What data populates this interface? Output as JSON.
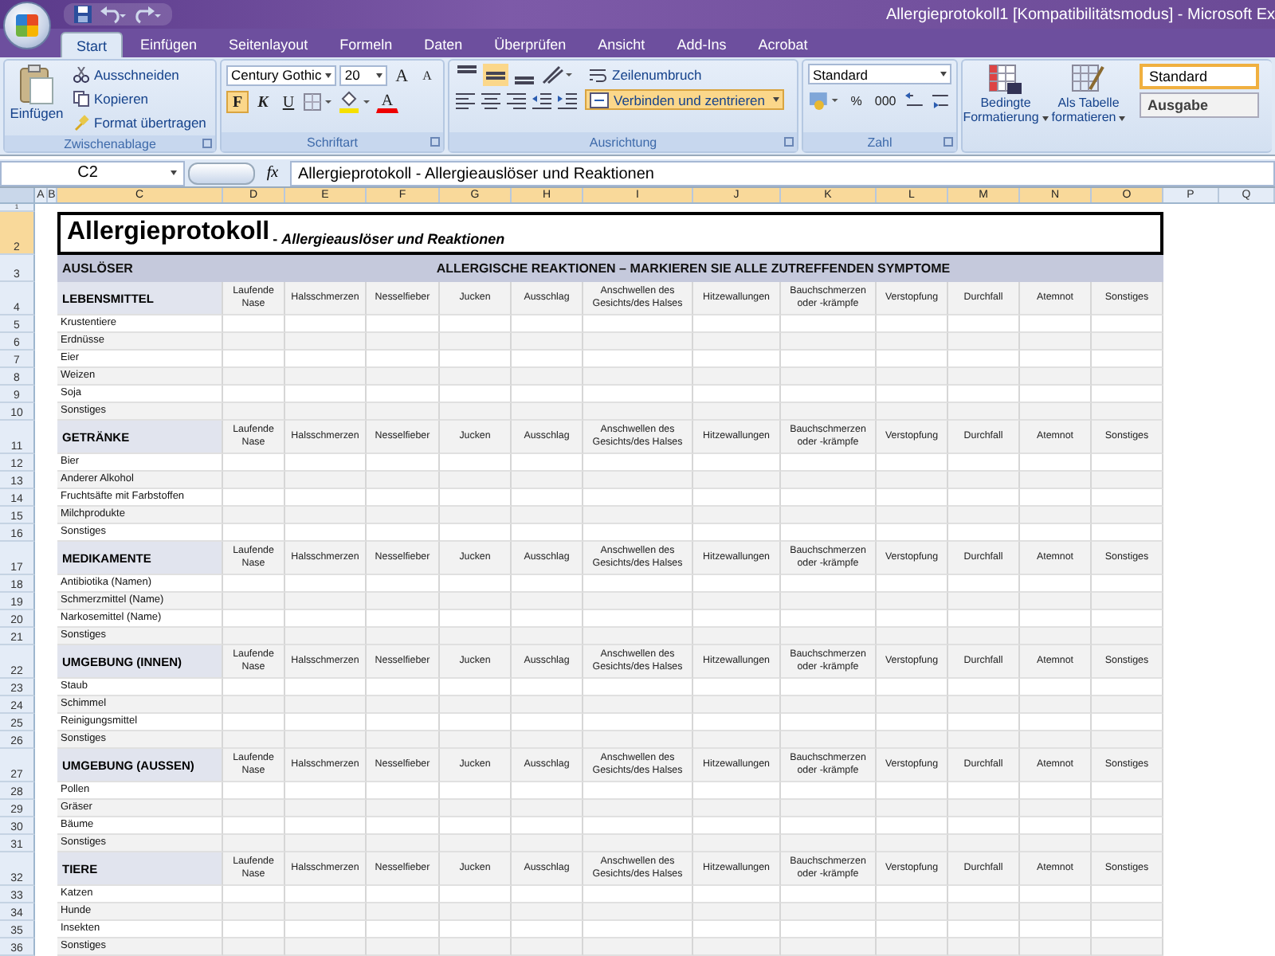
{
  "window": {
    "title": "Allergieprotokoll1  [Kompatibilitätsmodus] - Microsoft Ex"
  },
  "tabs": [
    {
      "label": "Start",
      "selected": true
    },
    {
      "label": "Einfügen",
      "selected": false
    },
    {
      "label": "Seitenlayout",
      "selected": false
    },
    {
      "label": "Formeln",
      "selected": false
    },
    {
      "label": "Daten",
      "selected": false
    },
    {
      "label": "Überprüfen",
      "selected": false
    },
    {
      "label": "Ansicht",
      "selected": false
    },
    {
      "label": "Add-Ins",
      "selected": false
    },
    {
      "label": "Acrobat",
      "selected": false
    }
  ],
  "ribbon": {
    "clipboard": {
      "paste": "Einfügen",
      "cut": "Ausschneiden",
      "copy": "Kopieren",
      "format_painter": "Format übertragen",
      "label": "Zwischenablage"
    },
    "font": {
      "name": "Century Gothic",
      "size": "20",
      "grow": "A",
      "shrink": "A",
      "bold": {
        "label": "F",
        "pressed": true
      },
      "italic": {
        "label": "K",
        "pressed": false
      },
      "underline": {
        "label": "U",
        "pressed": false
      },
      "font_color": "A",
      "label": "Schriftart"
    },
    "alignment": {
      "wrap": "Zeilenumbruch",
      "merge": {
        "label": "Verbinden und zentrieren",
        "pressed": true
      },
      "label": "Ausrichtung"
    },
    "number": {
      "format": "Standard",
      "percent": "%",
      "thousands": "000",
      "label": "Zahl"
    },
    "styles": {
      "conditional": [
        "Bedingte",
        "Formatierung"
      ],
      "as_table": [
        "Als Tabelle",
        "formatieren"
      ],
      "cells": [
        {
          "label": "Standard",
          "selected": true
        },
        {
          "label": "Ausgabe",
          "selected": false
        }
      ]
    }
  },
  "formula_bar": {
    "name_box": "C2",
    "fx": "fx",
    "content": "Allergieprotokoll - Allergieauslöser und Reaktionen"
  },
  "columns": [
    {
      "label": "A",
      "selected": false
    },
    {
      "label": "B",
      "selected": false
    },
    {
      "label": "C",
      "selected": true
    },
    {
      "label": "D",
      "selected": true
    },
    {
      "label": "E",
      "selected": true
    },
    {
      "label": "F",
      "selected": true
    },
    {
      "label": "G",
      "selected": true
    },
    {
      "label": "H",
      "selected": true
    },
    {
      "label": "I",
      "selected": true
    },
    {
      "label": "J",
      "selected": true
    },
    {
      "label": "K",
      "selected": true
    },
    {
      "label": "L",
      "selected": true
    },
    {
      "label": "M",
      "selected": true
    },
    {
      "label": "N",
      "selected": true
    },
    {
      "label": "O",
      "selected": true
    },
    {
      "label": "P",
      "selected": false
    },
    {
      "label": "Q",
      "selected": false
    }
  ],
  "sheet": {
    "first_row": "1",
    "title_row": {
      "number": "2",
      "selected": true,
      "title": "Allergieprotokoll",
      "subtitle": " - *Allergieauslöser und Reaktionen*"
    },
    "header_row": {
      "number": "3",
      "trigger": "AUSLÖSER",
      "reactions": "ALLERGISCHE REAKTIONEN – MARKIEREN SIE ALLE ZUTREFFENDEN SYMPTOME"
    },
    "sections": [
      {
        "number": "4",
        "title": "LEBENSMITTEL",
        "symptoms": [
          "Laufende Nase",
          "Halsschmerzen",
          "Nesselfieber",
          "Jucken",
          "Ausschlag",
          "Anschwellen des Gesichts/des Halses",
          "Hitzewallungen",
          "Bauchschmerzen oder -krämpfe",
          "Verstopfung",
          "Durchfall",
          "Atemnot",
          "Sonstiges"
        ],
        "items": [
          {
            "number": "5",
            "label": "Krustentiere"
          },
          {
            "number": "6",
            "label": "Erdnüsse"
          },
          {
            "number": "7",
            "label": "Eier"
          },
          {
            "number": "8",
            "label": "Weizen"
          },
          {
            "number": "9",
            "label": "Soja"
          },
          {
            "number": "10",
            "label": "Sonstiges"
          }
        ]
      },
      {
        "number": "11",
        "title": "GETRÄNKE",
        "symptoms": [
          "Laufende Nase",
          "Halsschmerzen",
          "Nesselfieber",
          "Jucken",
          "Ausschlag",
          "Anschwellen des Gesichts/des Halses",
          "Hitzewallungen",
          "Bauchschmerzen oder -krämpfe",
          "Verstopfung",
          "Durchfall",
          "Atemnot",
          "Sonstiges"
        ],
        "items": [
          {
            "number": "12",
            "label": "Bier"
          },
          {
            "number": "13",
            "label": "Anderer Alkohol"
          },
          {
            "number": "14",
            "label": "Fruchtsäfte mit Farbstoffen"
          },
          {
            "number": "15",
            "label": "Milchprodukte"
          },
          {
            "number": "16",
            "label": "Sonstiges"
          }
        ]
      },
      {
        "number": "17",
        "title": "MEDIKAMENTE",
        "symptoms": [
          "Laufende Nase",
          "Halsschmerzen",
          "Nesselfieber",
          "Jucken",
          "Ausschlag",
          "Anschwellen des Gesichts/des Halses",
          "Hitzewallungen",
          "Bauchschmerzen oder -krämpfe",
          "Verstopfung",
          "Durchfall",
          "Atemnot",
          "Sonstiges"
        ],
        "items": [
          {
            "number": "18",
            "label": "Antibiotika (Namen)"
          },
          {
            "number": "19",
            "label": "Schmerzmittel (Name)"
          },
          {
            "number": "20",
            "label": "Narkosemittel (Name)"
          },
          {
            "number": "21",
            "label": "Sonstiges"
          }
        ]
      },
      {
        "number": "22",
        "title": "UMGEBUNG (INNEN)",
        "symptoms": [
          "Laufende Nase",
          "Halsschmerzen",
          "Nesselfieber",
          "Jucken",
          "Ausschlag",
          "Anschwellen des Gesichts/des Halses",
          "Hitzewallungen",
          "Bauchschmerzen oder -krämpfe",
          "Verstopfung",
          "Durchfall",
          "Atemnot",
          "Sonstiges"
        ],
        "items": [
          {
            "number": "23",
            "label": "Staub"
          },
          {
            "number": "24",
            "label": "Schimmel"
          },
          {
            "number": "25",
            "label": "Reinigungsmittel"
          },
          {
            "number": "26",
            "label": "Sonstiges"
          }
        ]
      },
      {
        "number": "27",
        "title": "UMGEBUNG (AUSSEN)",
        "symptoms": [
          "Laufende Nase",
          "Halsschmerzen",
          "Nesselfieber",
          "Jucken",
          "Ausschlag",
          "Anschwellen des Gesichts/des Halses",
          "Hitzewallungen",
          "Bauchschmerzen oder -krämpfe",
          "Verstopfung",
          "Durchfall",
          "Atemnot",
          "Sonstiges"
        ],
        "items": [
          {
            "number": "28",
            "label": "Pollen"
          },
          {
            "number": "29",
            "label": "Gräser"
          },
          {
            "number": "30",
            "label": "Bäume"
          },
          {
            "number": "31",
            "label": "Sonstiges"
          }
        ]
      },
      {
        "number": "32",
        "title": "TIERE",
        "symptoms": [
          "Laufende Nase",
          "Halsschmerzen",
          "Nesselfieber",
          "Jucken",
          "Ausschlag",
          "Anschwellen des Gesichts/des Halses",
          "Hitzewallungen",
          "Bauchschmerzen oder -krämpfe",
          "Verstopfung",
          "Durchfall",
          "Atemnot",
          "Sonstiges"
        ],
        "items": [
          {
            "number": "33",
            "label": "Katzen"
          },
          {
            "number": "34",
            "label": "Hunde"
          },
          {
            "number": "35",
            "label": "Insekten"
          },
          {
            "number": "36",
            "label": "Sonstiges"
          }
        ]
      }
    ]
  }
}
